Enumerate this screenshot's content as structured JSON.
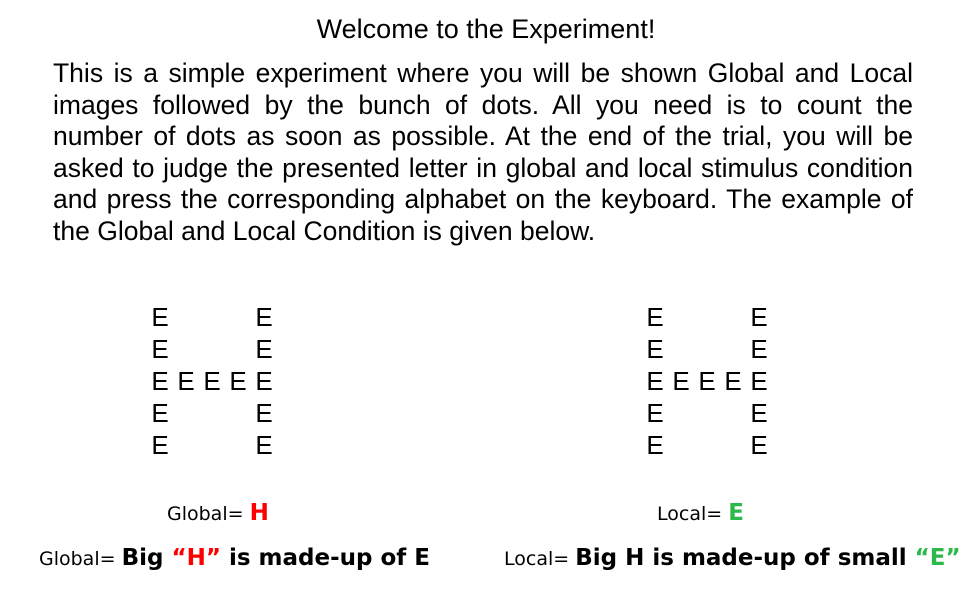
{
  "title": "Welcome to the Experiment!",
  "intro": "This is a simple experiment where you will be shown Global and Local images followed by the bunch of dots. All you need is to count the number of dots as soon as possible. At the end of the trial, you will be asked to judge the presented letter in global and local stimulus condition and press the corresponding alphabet on the keyboard. The example of the Global and Local Condition is given below.",
  "letter": "E",
  "global_caption": {
    "label": "Global= ",
    "value": "H",
    "value_color": "#ff0000"
  },
  "local_caption": {
    "label": "Local= ",
    "value": "E",
    "value_color": "#2db84a"
  },
  "global_description": {
    "label": "Global= ",
    "before": "Big ",
    "quoted": "“H”",
    "quoted_color": "#ff0000",
    "after": " is made-up of E"
  },
  "local_description": {
    "label": "Local= ",
    "before": "Big H is made-up of small ",
    "quoted": "“E”",
    "quoted_color": "#2db84a",
    "after": ""
  }
}
